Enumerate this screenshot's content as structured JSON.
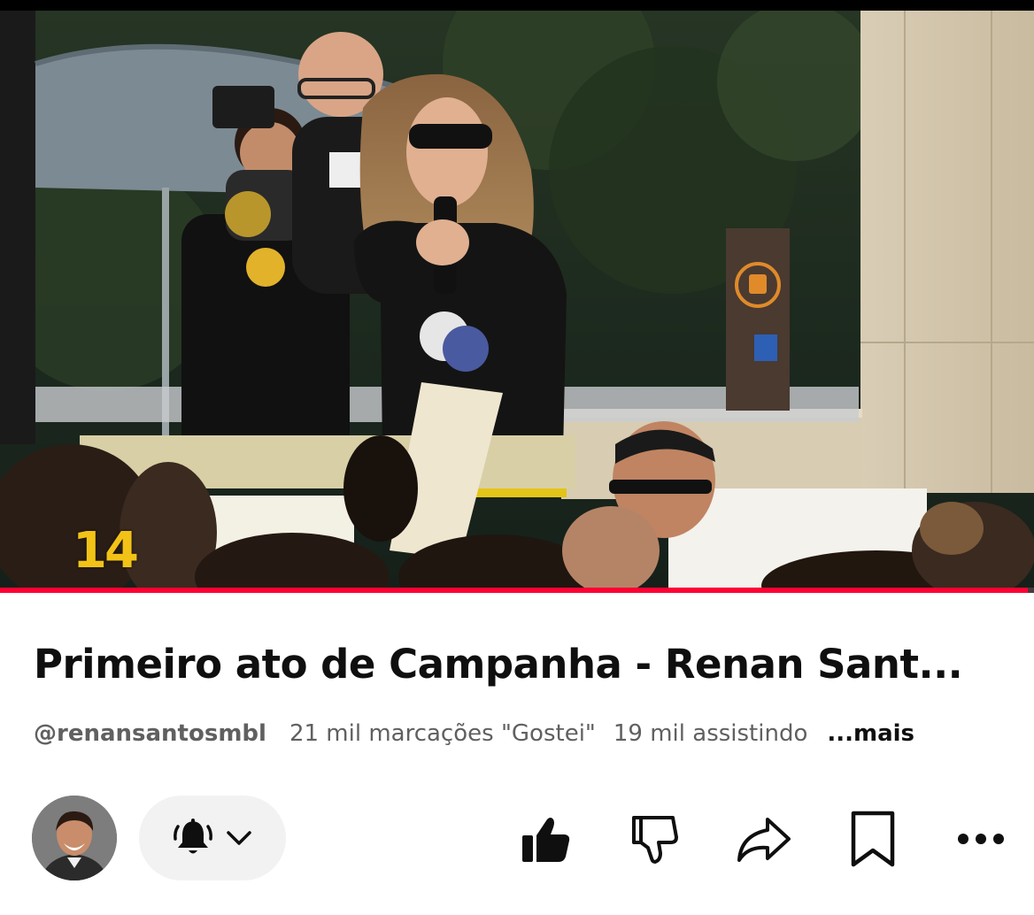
{
  "video": {
    "watermark": "14",
    "progress_fraction": 0.994
  },
  "info": {
    "title": "Primeiro ato de Campanha - Renan Sant...",
    "channel_handle": "@renansantosmbl",
    "likes": "21 mil marcações \"Gostei\"",
    "watching": "19 mil assistindo",
    "more_label": "...mais"
  },
  "actions": {
    "subscribe_icon": "bell-ringing-icon",
    "like_icon": "thumbs-up-filled-icon",
    "dislike_icon": "thumbs-down-icon",
    "share_icon": "share-arrow-icon",
    "save_icon": "bookmark-icon",
    "more_icon": "more-horizontal-icon"
  },
  "colors": {
    "progress": "#ff0033",
    "text_primary": "#0f0f0f",
    "text_secondary": "#606060",
    "pill_bg": "#f2f2f2",
    "watermark": "#f2c316"
  }
}
